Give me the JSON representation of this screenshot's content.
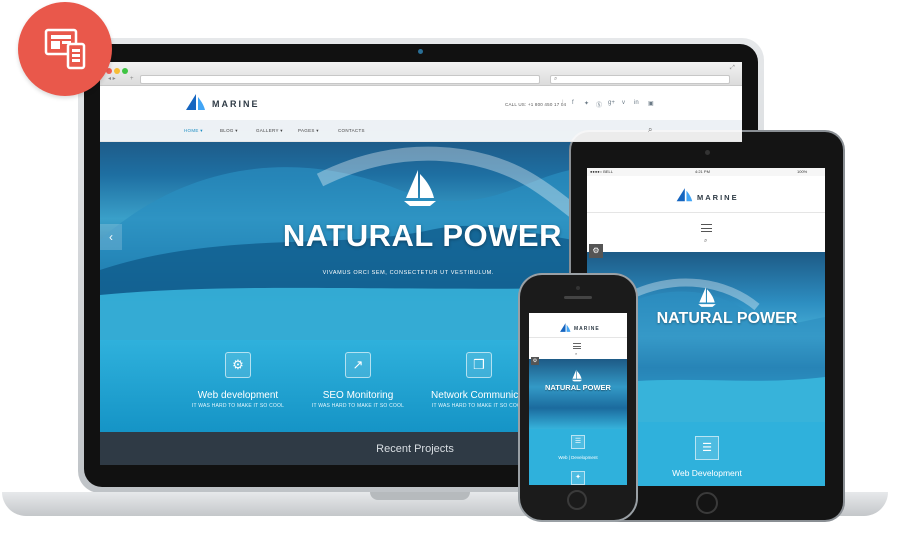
{
  "colors": {
    "accent": "#2fb1dc",
    "badge": "#e9584b",
    "dark": "#2f3a45",
    "brand_blue": "#1565c0"
  },
  "badge": {
    "icon": "responsive-devices-icon"
  },
  "laptop": {
    "header": {
      "brand": "MARINE",
      "call_us": "CALL US: +1 800 450 17 04",
      "social_icons": [
        "facebook-icon",
        "twitter-icon",
        "skype-icon",
        "google-plus-icon",
        "vine-icon",
        "linkedin-icon",
        "instagram-icon"
      ]
    },
    "nav": {
      "items": [
        "HOME ▾",
        "BLOG ▾",
        "GALLERY ▾",
        "PAGES ▾",
        "CONTACTS"
      ]
    },
    "hero": {
      "title": "NATURAL POWER",
      "subtitle": "VIVAMUS ORCI SEM, CONSECTETUR UT VESTIBULUM."
    },
    "services": [
      {
        "title": "Web development",
        "sub": "IT WAS HARD TO MAKE IT SO COOL",
        "icon": "gear-icon"
      },
      {
        "title": "SEO Monitoring",
        "sub": "IT WAS HARD TO MAKE IT SO COOL",
        "icon": "chart-icon"
      },
      {
        "title": "Network Communications",
        "sub": "IT WAS HARD TO MAKE IT SO COOL",
        "icon": "gift-icon"
      }
    ],
    "recent_title": "Recent Projects"
  },
  "tablet": {
    "status": {
      "carrier": "●●●●○ BELL",
      "time": "4:21 PM",
      "battery": "100%"
    },
    "brand": "MARINE",
    "hero_title": "NATURAL POWER",
    "service_title": "Web Development"
  },
  "phone": {
    "brand": "MARINE",
    "hero_title": "NATURAL POWER",
    "service_title": "Web | Development"
  }
}
